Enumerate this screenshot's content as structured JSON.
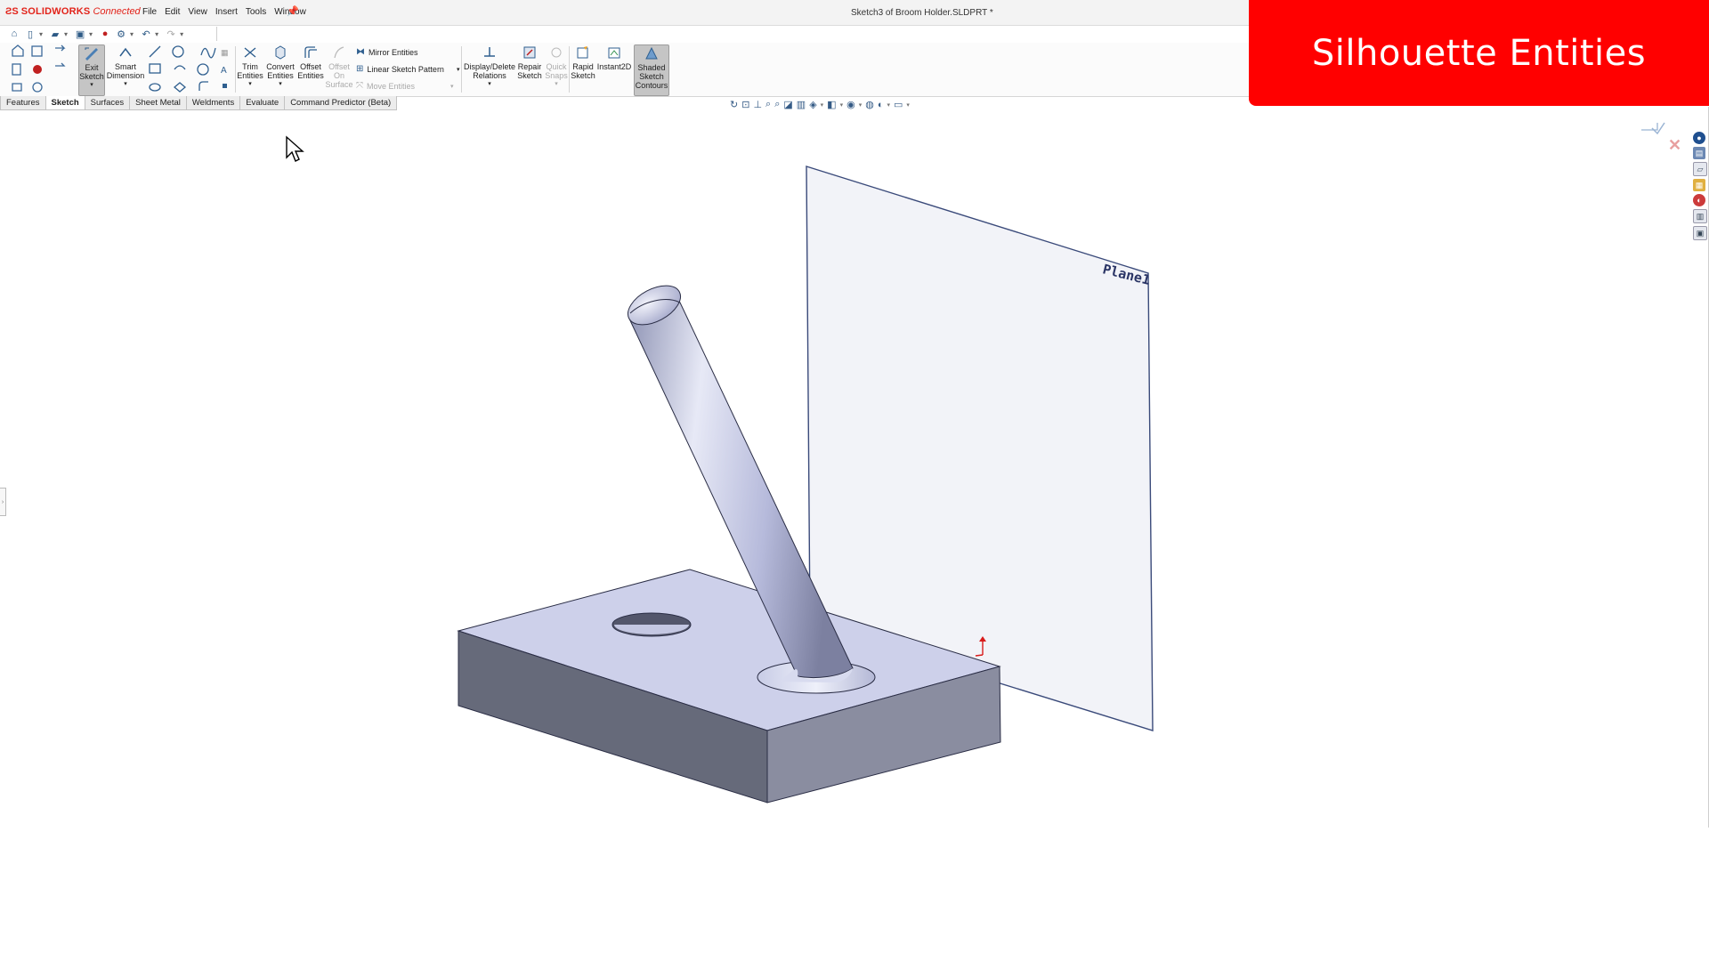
{
  "app": {
    "brand_ds": "ƧS",
    "brand_name": "SOLIDWORKS",
    "brand_suffix": "Connected",
    "document_title": "Sketch3 of Broom Holder.SLDPRT *"
  },
  "menu": [
    "File",
    "Edit",
    "View",
    "Insert",
    "Tools",
    "Window"
  ],
  "ribbon": {
    "exit_sketch": [
      "Exit",
      "Sketch"
    ],
    "smart_dimension": [
      "Smart",
      "Dimension"
    ],
    "trim_entities": [
      "Trim",
      "Entities"
    ],
    "convert_entities": [
      "Convert",
      "Entities"
    ],
    "offset_entities": [
      "Offset",
      "Entities"
    ],
    "offset_on_surface": [
      "Offset",
      "On",
      "Surface"
    ],
    "mirror_entities": "Mirror Entities",
    "linear_sketch_pattern": "Linear Sketch Pattern",
    "move_entities": "Move Entities",
    "display_delete_relations": [
      "Display/Delete",
      "Relations"
    ],
    "repair_sketch": [
      "Repair",
      "Sketch"
    ],
    "quick_snaps": [
      "Quick",
      "Snaps"
    ],
    "rapid_sketch": [
      "Rapid",
      "Sketch"
    ],
    "instant2d": "Instant2D",
    "shaded_sketch_contours": [
      "Shaded",
      "Sketch",
      "Contours"
    ]
  },
  "tabs": [
    {
      "label": "Features",
      "active": false
    },
    {
      "label": "Sketch",
      "active": true
    },
    {
      "label": "Surfaces",
      "active": false
    },
    {
      "label": "Sheet Metal",
      "active": false
    },
    {
      "label": "Weldments",
      "active": false
    },
    {
      "label": "Evaluate",
      "active": false
    },
    {
      "label": "Command Predictor (Beta)",
      "active": false
    }
  ],
  "viewport": {
    "plane_label": "Plane1"
  },
  "banner": {
    "text": "Silhouette Entities",
    "color": "#ff0000"
  },
  "colors": {
    "accent_red": "#e2231a",
    "model_top": "#cdd0ea",
    "model_side_dark": "#666a7a",
    "model_side_light": "#8a8da0",
    "plane_fill": "#f2f3f8",
    "plane_edge": "#3a4a7a"
  }
}
